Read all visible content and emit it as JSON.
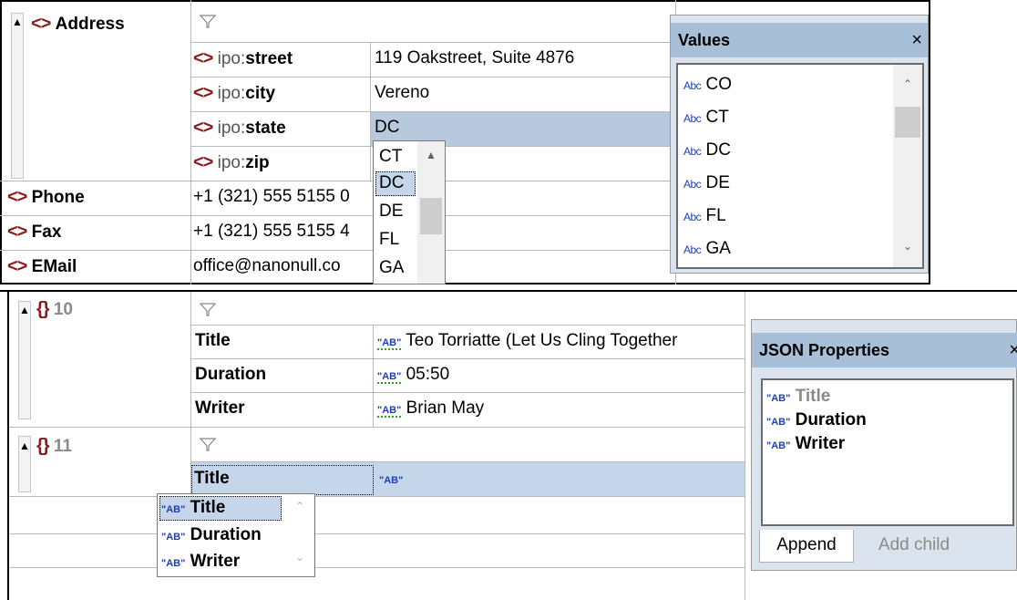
{
  "xml_grid": {
    "address": {
      "label": "Address"
    },
    "fields": [
      {
        "prefix": "ipo:",
        "name": "street",
        "value": "119 Oakstreet, Suite 4876"
      },
      {
        "prefix": "ipo:",
        "name": "city",
        "value": "Vereno"
      },
      {
        "prefix": "ipo:",
        "name": "state",
        "value": "DC"
      },
      {
        "prefix": "ipo:",
        "name": "zip",
        "value": ""
      }
    ],
    "rows": [
      {
        "label": "Phone",
        "value": "+1 (321) 555 5155 0"
      },
      {
        "label": "Fax",
        "value": "+1 (321) 555 5155 4"
      },
      {
        "label": "EMail",
        "value": "office@nanonull.co"
      }
    ],
    "state_dropdown": {
      "items": [
        "CT",
        "DC",
        "DE",
        "FL",
        "GA"
      ],
      "selected": "DC"
    }
  },
  "values_panel": {
    "title": "Values",
    "close": "×",
    "type_icon": "Abc",
    "items": [
      "CO",
      "CT",
      "DC",
      "DE",
      "FL",
      "GA"
    ]
  },
  "json_grid": {
    "item10": {
      "index": "10",
      "rows": [
        {
          "key": "Title",
          "value": "Teo Torriatte (Let Us Cling Together"
        },
        {
          "key": "Duration",
          "value": "05:50"
        },
        {
          "key": "Writer",
          "value": "Brian May"
        }
      ]
    },
    "item11": {
      "index": "11",
      "key": "Title"
    },
    "string_icon": "\"AB\"",
    "key_dropdown": {
      "items": [
        "Title",
        "Duration",
        "Writer"
      ],
      "selected": "Title"
    }
  },
  "json_panel": {
    "title": "JSON Properties",
    "close": "×",
    "items": [
      "Title",
      "Duration",
      "Writer"
    ],
    "tabs": [
      "Append",
      "Add child"
    ]
  },
  "icons": {
    "element": "<>",
    "object": "{}"
  },
  "colors": {
    "element": "#8b1a1a",
    "selection": "#b8c8dd",
    "panel_header": "#a8bfd8",
    "string_icon": "#1c3eb8"
  }
}
